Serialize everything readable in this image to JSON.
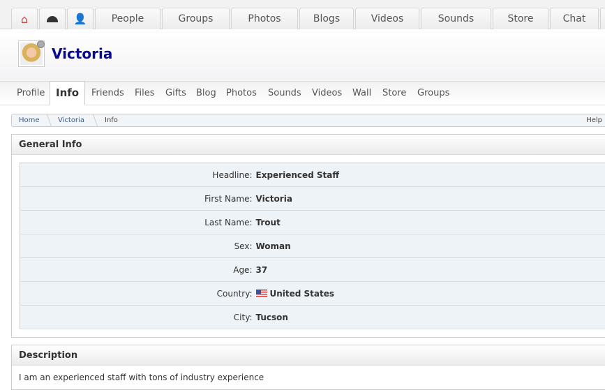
{
  "top_nav": {
    "items": [
      "People",
      "Groups",
      "Photos",
      "Blogs",
      "Videos",
      "Sounds",
      "Store",
      "Chat"
    ]
  },
  "profile": {
    "name": "Victoria"
  },
  "sub_nav": {
    "items": [
      "Profile",
      "Info",
      "Friends",
      "Files",
      "Gifts",
      "Blog",
      "Photos",
      "Sounds",
      "Videos",
      "Wall",
      "Store",
      "Groups"
    ],
    "active": "Info"
  },
  "breadcrumb": {
    "items": [
      "Home",
      "Victoria",
      "Info"
    ],
    "right": "Help"
  },
  "general_info": {
    "title": "General Info",
    "rows": [
      {
        "label": "Headline:",
        "value": "Experienced Staff"
      },
      {
        "label": "First Name:",
        "value": "Victoria"
      },
      {
        "label": "Last Name:",
        "value": "Trout"
      },
      {
        "label": "Sex:",
        "value": "Woman"
      },
      {
        "label": "Age:",
        "value": "37"
      },
      {
        "label": "Country:",
        "value": "United States"
      },
      {
        "label": "City:",
        "value": "Tucson"
      }
    ]
  },
  "description": {
    "title": "Description",
    "text": "I am an experienced staff with tons of industry experience"
  }
}
